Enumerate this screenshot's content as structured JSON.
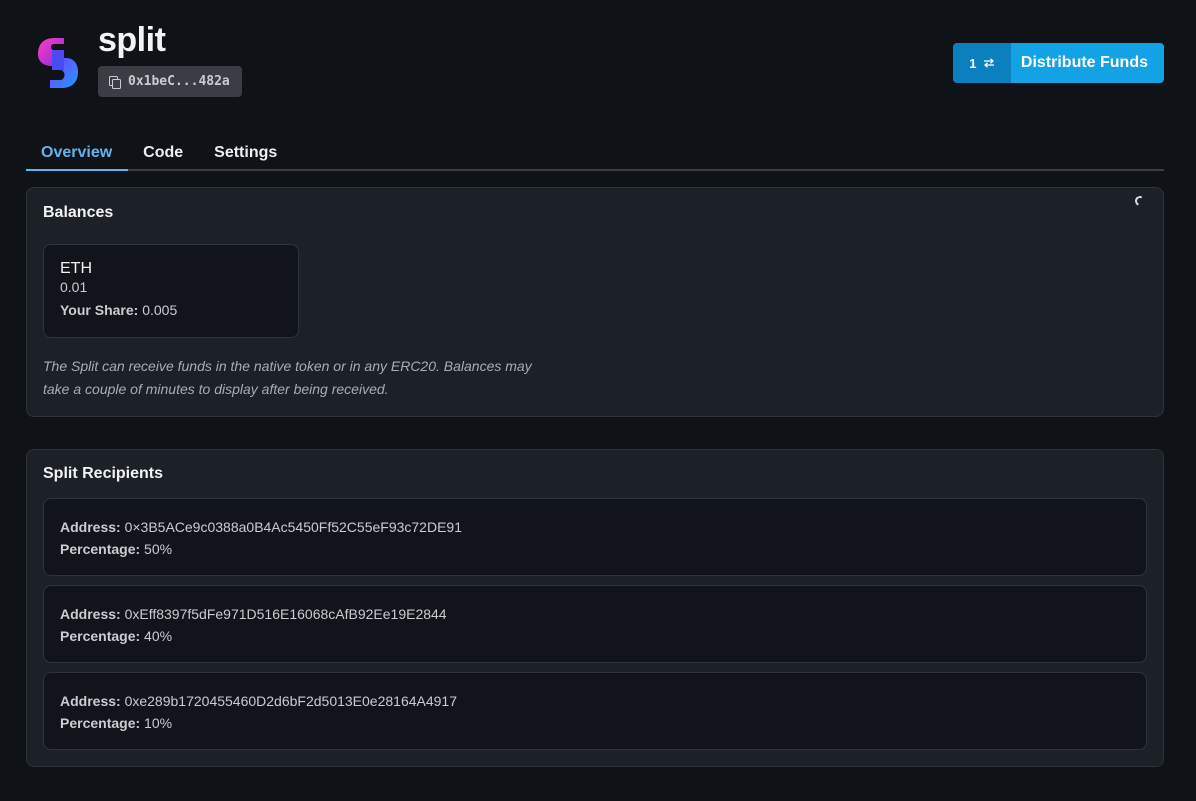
{
  "header": {
    "title": "split",
    "address_short": "0x1beC...482a",
    "distribute_count": "1",
    "distribute_label": "Distribute Funds"
  },
  "tabs": [
    {
      "label": "Overview",
      "active": true
    },
    {
      "label": "Code",
      "active": false
    },
    {
      "label": "Settings",
      "active": false
    }
  ],
  "balances": {
    "title": "Balances",
    "tokens": [
      {
        "symbol": "ETH",
        "amount": "0.01",
        "share_label": "Your Share:",
        "share_value": "0.005"
      }
    ],
    "note": "The Split can receive funds in the native token or in any ERC20. Balances may take a couple of minutes to display after being received."
  },
  "recipients": {
    "title": "Split Recipients",
    "address_label": "Address:",
    "percentage_label": "Percentage:",
    "items": [
      {
        "address": "0×3B5ACe9c0388a0B4Ac5450Ff52C55eF93c72DE91",
        "percentage": "50%"
      },
      {
        "address": "0xEff8397f5dFe971D516E16068cAfB92Ee19E2844",
        "percentage": "40%"
      },
      {
        "address": "0xe289b1720455460D2d6bF2d5013E0e28164A4917",
        "percentage": "10%"
      }
    ]
  },
  "colors": {
    "background": "#0f1217",
    "card": "#1c2027",
    "accent_tab": "#63b3ed",
    "button_primary": "#13a2e5",
    "button_secondary": "#0c7fbf"
  },
  "icons": {
    "logo": "split-logo",
    "copy": "copy-icon",
    "swap": "swap-arrows-icon",
    "loading": "spinner-icon"
  }
}
